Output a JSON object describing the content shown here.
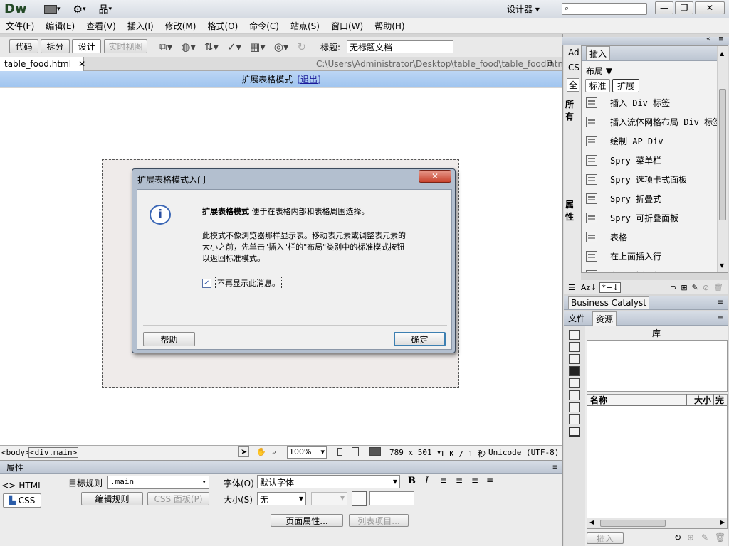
{
  "app": {
    "logo": "Dw",
    "workspace": "设计器"
  },
  "menu": [
    "文件(F)",
    "编辑(E)",
    "查看(V)",
    "插入(I)",
    "修改(M)",
    "格式(O)",
    "命令(C)",
    "站点(S)",
    "窗口(W)",
    "帮助(H)"
  ],
  "doc_toolbar": {
    "code": "代码",
    "split": "拆分",
    "design": "设计",
    "live": "实时视图",
    "title_label": "标题:",
    "title_value": "无标题文档"
  },
  "tab": {
    "filename": "table_food.html",
    "path": "C:\\Users\\Administrator\\Desktop\\table_food\\table_food.html"
  },
  "expanded_bar": {
    "label": "扩展表格模式",
    "exit": "[退出]"
  },
  "dialog": {
    "title": "扩展表格模式入门",
    "bold": "扩展表格模式",
    "line1_rest": " 便于在表格内部和表格周围选择。",
    "para2_l1": "此模式不像浏览器那样显示表。移动表元素或调整表元素的",
    "para2_l2": "大小之前，先单击\"插入\"栏的\"布局\"类别中的标准模式按钮",
    "para2_l3": "以返回标准模式。",
    "checkbox": "不再显示此消息。",
    "help": "帮助",
    "ok": "确定"
  },
  "status": {
    "tag1": "<body>",
    "tag2": "<div.main>",
    "zoom": "100%",
    "dims": "789 x 501",
    "size": "1 K / 1 秒",
    "encoding": "Unicode (UTF-8)"
  },
  "properties": {
    "title": "属性",
    "html": "HTML",
    "css": "CSS",
    "target_rule_label": "目标规则",
    "target_rule": ".main",
    "edit_rule": "编辑规则",
    "css_panel": "CSS 面板(P)",
    "font_label": "字体(O)",
    "font_value": "默认字体",
    "size_label": "大小(S)",
    "size_value": "无",
    "page_props": "页面属性...",
    "list_item": "列表项目..."
  },
  "insert_panel": {
    "tab": "插入",
    "category": "布局",
    "sub_std": "标准",
    "sub_ext": "扩展",
    "items": [
      "插入 Div 标签",
      "插入流体网格布局 Div 标签",
      "绘制 AP Div",
      "Spry 菜单栏",
      "Spry 选项卡式面板",
      "Spry 折叠式",
      "Spry 可折叠面板",
      "表格",
      "在上面插入行",
      "在下面插入行"
    ]
  },
  "left_stubs": {
    "ad": "Ad",
    "cs": "CS",
    "all": "全",
    "all2": "所有",
    "attr": "属性"
  },
  "bc_panel": "Business Catalyst",
  "assets": {
    "tab_files": "文件",
    "tab_assets": "资源",
    "lib": "库",
    "col_name": "名称",
    "col_size": "大小",
    "col_full": "完",
    "insert": "插入"
  },
  "azl": "Az↓"
}
